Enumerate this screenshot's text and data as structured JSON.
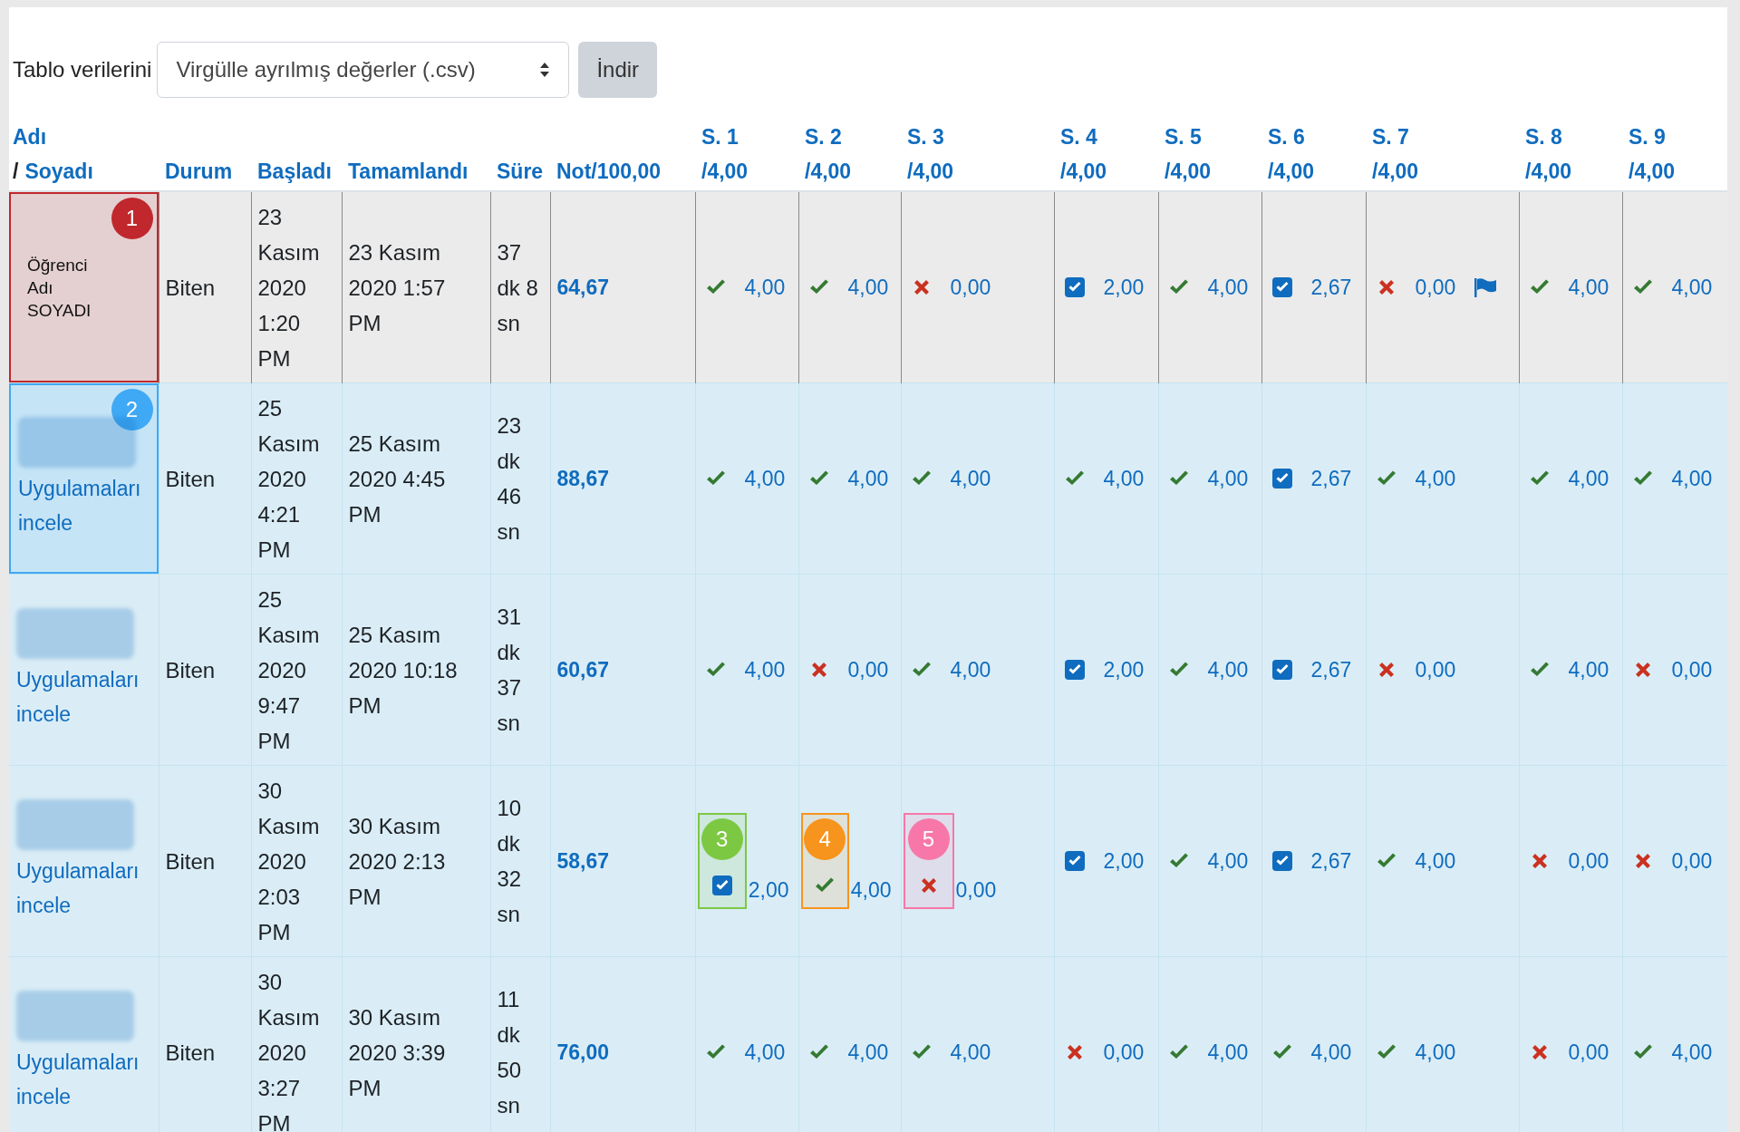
{
  "toolbar": {
    "label": "Tablo verilerini",
    "format_select": {
      "value": "Virgülle ayrılmış değerler (.csv)"
    },
    "download_button": "İndir"
  },
  "columns": {
    "first_name": "Adı",
    "separator": "/",
    "last_name": "Soyadı",
    "status": "Durum",
    "started": "Başladı",
    "completed": "Tamamlandı",
    "duration": "Süre",
    "grade": "Not/100,00",
    "questions": [
      {
        "label": "S. 1",
        "max": "/4,00"
      },
      {
        "label": "S. 2",
        "max": "/4,00"
      },
      {
        "label": "S. 3",
        "max": "/4,00"
      },
      {
        "label": "S. 4",
        "max": "/4,00"
      },
      {
        "label": "S. 5",
        "max": "/4,00"
      },
      {
        "label": "S. 6",
        "max": "/4,00"
      },
      {
        "label": "S. 7",
        "max": "/4,00"
      },
      {
        "label": "S. 8",
        "max": "/4,00"
      },
      {
        "label": "S. 9",
        "max": "/4,00"
      }
    ]
  },
  "rows": [
    {
      "highlighted": true,
      "name": {
        "kind": "text",
        "text": "Öğrenci Adı SOYADI"
      },
      "callout": {
        "number": "1",
        "color": "#c0282d"
      },
      "status": "Biten",
      "started": "23 Kasım 2020 1:20 PM",
      "completed": "23 Kasım 2020 1:57 PM",
      "duration": "37 dk 8 sn",
      "grade": "64,67",
      "marks": [
        {
          "kind": "correct",
          "value": "4,00",
          "flagged": false
        },
        {
          "kind": "correct",
          "value": "4,00",
          "flagged": false
        },
        {
          "kind": "incorrect",
          "value": "0,00",
          "flagged": false
        },
        {
          "kind": "partial",
          "value": "2,00",
          "flagged": false
        },
        {
          "kind": "correct",
          "value": "4,00",
          "flagged": false
        },
        {
          "kind": "partial",
          "value": "2,67",
          "flagged": false
        },
        {
          "kind": "incorrect",
          "value": "0,00",
          "flagged": true
        },
        {
          "kind": "correct",
          "value": "4,00",
          "flagged": false
        },
        {
          "kind": "correct",
          "value": "4,00",
          "flagged": false
        }
      ]
    },
    {
      "highlighted": false,
      "name": {
        "kind": "blurred",
        "link": "Uygulamaları incele"
      },
      "callout": {
        "number": "2",
        "color": "#3fa9f5"
      },
      "status": "Biten",
      "started": "25 Kasım 2020 4:21 PM",
      "completed": "25 Kasım 2020 4:45 PM",
      "duration": "23 dk 46 sn",
      "grade": "88,67",
      "marks": [
        {
          "kind": "correct",
          "value": "4,00",
          "flagged": false
        },
        {
          "kind": "correct",
          "value": "4,00",
          "flagged": false
        },
        {
          "kind": "correct",
          "value": "4,00",
          "flagged": false
        },
        {
          "kind": "correct",
          "value": "4,00",
          "flagged": false
        },
        {
          "kind": "correct",
          "value": "4,00",
          "flagged": false
        },
        {
          "kind": "partial",
          "value": "2,67",
          "flagged": false
        },
        {
          "kind": "correct",
          "value": "4,00",
          "flagged": false
        },
        {
          "kind": "correct",
          "value": "4,00",
          "flagged": false
        },
        {
          "kind": "correct",
          "value": "4,00",
          "flagged": false
        }
      ]
    },
    {
      "highlighted": false,
      "name": {
        "kind": "blurred",
        "link": "Uygulamaları incele"
      },
      "status": "Biten",
      "started": "25 Kasım 2020 9:47 PM",
      "completed": "25 Kasım 2020 10:18 PM",
      "duration": "31 dk 37 sn",
      "grade": "60,67",
      "marks": [
        {
          "kind": "correct",
          "value": "4,00",
          "flagged": false
        },
        {
          "kind": "incorrect",
          "value": "0,00",
          "flagged": false
        },
        {
          "kind": "correct",
          "value": "4,00",
          "flagged": false
        },
        {
          "kind": "partial",
          "value": "2,00",
          "flagged": false
        },
        {
          "kind": "correct",
          "value": "4,00",
          "flagged": false
        },
        {
          "kind": "partial",
          "value": "2,67",
          "flagged": false
        },
        {
          "kind": "incorrect",
          "value": "0,00",
          "flagged": false
        },
        {
          "kind": "correct",
          "value": "4,00",
          "flagged": false
        },
        {
          "kind": "incorrect",
          "value": "0,00",
          "flagged": false
        }
      ]
    },
    {
      "highlighted": false,
      "name": {
        "kind": "blurred",
        "link": "Uygulamaları incele"
      },
      "status": "Biten",
      "started": "30 Kasım 2020 2:03 PM",
      "completed": "30 Kasım 2020 2:13 PM",
      "duration": "10 dk 32 sn",
      "grade": "58,67",
      "marks": [
        {
          "kind": "partial",
          "value": "2,00",
          "flagged": false,
          "callout": {
            "number": "3",
            "color": "#7dc843"
          }
        },
        {
          "kind": "correct",
          "value": "4,00",
          "flagged": false,
          "callout": {
            "number": "4",
            "color": "#f7941d"
          }
        },
        {
          "kind": "incorrect",
          "value": "0,00",
          "flagged": false,
          "callout": {
            "number": "5",
            "color": "#f778a8"
          }
        },
        {
          "kind": "partial",
          "value": "2,00",
          "flagged": false
        },
        {
          "kind": "correct",
          "value": "4,00",
          "flagged": false
        },
        {
          "kind": "partial",
          "value": "2,67",
          "flagged": false
        },
        {
          "kind": "correct",
          "value": "4,00",
          "flagged": false
        },
        {
          "kind": "incorrect",
          "value": "0,00",
          "flagged": false
        },
        {
          "kind": "incorrect",
          "value": "0,00",
          "flagged": false
        }
      ]
    },
    {
      "highlighted": false,
      "name": {
        "kind": "blurred",
        "link": "Uygulamaları incele"
      },
      "status": "Biten",
      "started": "30 Kasım 2020 3:27 PM",
      "completed": "30 Kasım 2020 3:39 PM",
      "duration": "11 dk 50 sn",
      "grade": "76,00",
      "marks": [
        {
          "kind": "correct",
          "value": "4,00",
          "flagged": false
        },
        {
          "kind": "correct",
          "value": "4,00",
          "flagged": false
        },
        {
          "kind": "correct",
          "value": "4,00",
          "flagged": false
        },
        {
          "kind": "incorrect",
          "value": "0,00",
          "flagged": false
        },
        {
          "kind": "correct",
          "value": "4,00",
          "flagged": false
        },
        {
          "kind": "correct",
          "value": "4,00",
          "flagged": false
        },
        {
          "kind": "correct",
          "value": "4,00",
          "flagged": false
        },
        {
          "kind": "incorrect",
          "value": "0,00",
          "flagged": false
        },
        {
          "kind": "correct",
          "value": "4,00",
          "flagged": false
        }
      ]
    }
  ]
}
